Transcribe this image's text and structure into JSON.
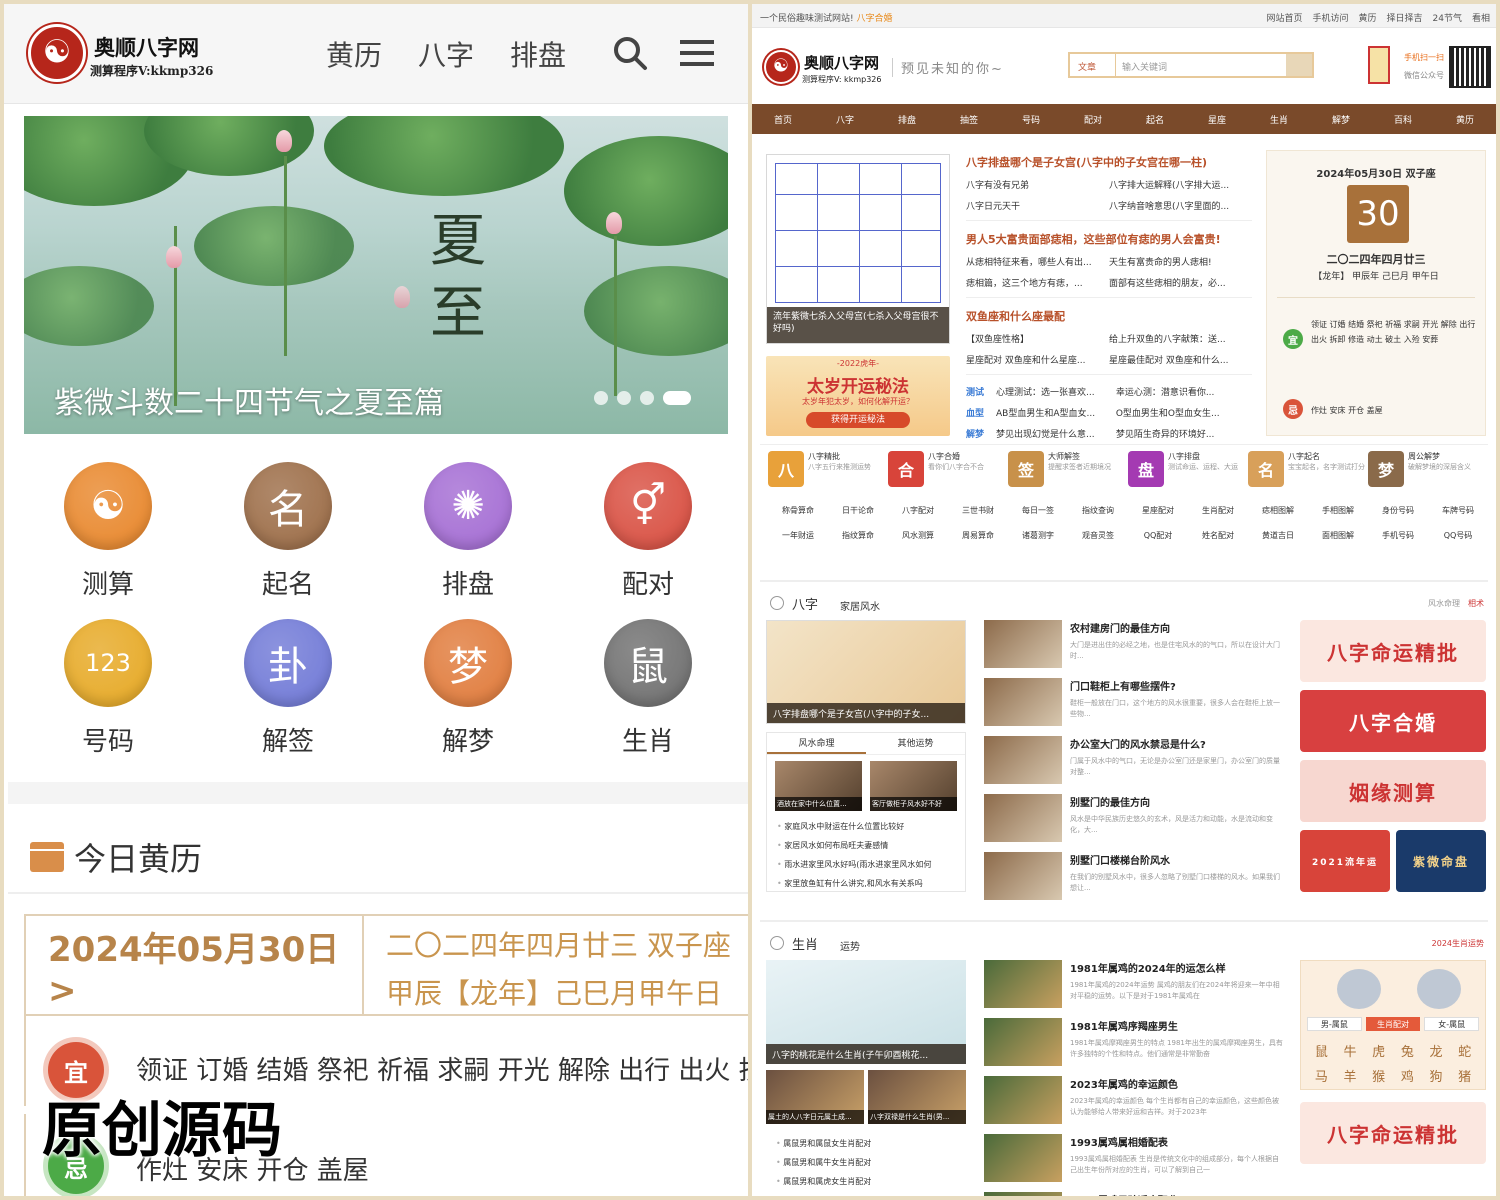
{
  "mobile": {
    "logo_name": "奥顺八字网",
    "logo_version": "测算程序V:kkmp326",
    "nav": [
      "黄历",
      "八字",
      "排盘"
    ],
    "banner": {
      "title_1": "夏",
      "title_2": "至",
      "caption": "紫微斗数二十四节气之夏至篇",
      "slides": 4,
      "active_slide": 4
    },
    "grid": [
      {
        "label": "测算",
        "icon": "yin-yang-icon",
        "color": "#e8862a",
        "glyph": "☯"
      },
      {
        "label": "起名",
        "icon": "name-seal-icon",
        "color": "#9b6b45",
        "glyph": "名"
      },
      {
        "label": "排盘",
        "icon": "compass-wheel-icon",
        "color": "#a36bd3",
        "glyph": "✺"
      },
      {
        "label": "配对",
        "icon": "gender-pair-icon",
        "color": "#d84d3f",
        "glyph": "⚥"
      },
      {
        "label": "号码",
        "icon": "number-123-icon",
        "color": "#e6a823",
        "glyph": "123"
      },
      {
        "label": "解签",
        "icon": "lottery-stick-icon",
        "color": "#6f78d6",
        "glyph": "卦"
      },
      {
        "label": "解梦",
        "icon": "dream-icon",
        "color": "#e07a3a",
        "glyph": "梦"
      },
      {
        "label": "生肖",
        "icon": "zodiac-rat-icon",
        "color": "#6e6e6e",
        "glyph": "鼠"
      }
    ],
    "almanac_title": "今日黄历",
    "date_solar": "2024年05月30日 >",
    "date_lunar_1": "二〇二四年四月廿三 双子座",
    "date_lunar_2": "甲辰【龙年】己巳月甲午日",
    "yi_label": "宜",
    "yi_text": "领证 订婚 结婚 祭祀 祈福 求嗣 开光 解除 出行 出火 拆",
    "ji_label": "忌",
    "ji_text": "作灶 安床 开仓 盖屋"
  },
  "watermark": "原创源码",
  "desktop": {
    "welcome": "一个民俗趣味测试网站!",
    "welcome_link": "八字合婚",
    "top_links": [
      "网站首页",
      "手机访问",
      "黄历",
      "择日择吉",
      "24节气",
      "看相"
    ],
    "logo_name": "奥顺八字网",
    "logo_version": "测算程序V: kkmp326",
    "slogan": "预见未知的你~",
    "search_select": "文章",
    "search_placeholder": "输入关键词",
    "qr_text": "手机扫一扫",
    "qr_text2": "微信公众号",
    "nav": [
      "首页",
      "八字",
      "排盘",
      "抽签",
      "号码",
      "配对",
      "起名",
      "星座",
      "生肖",
      "解梦",
      "百科",
      "黄历"
    ],
    "feature_caption": "流年紫微七杀入父母宫(七杀入父母宫很不好吗)",
    "ad_small": "-2022虎年-",
    "ad_title": "太岁开运秘法",
    "ad_sub": "太岁年犯太岁，如何化解开运？",
    "ad_button": "获得开运秘法",
    "articles": [
      {
        "title": "八字排盘哪个是子女宫(八字中的子女宫在哪一柱)",
        "rows": [
          [
            "八字有没有兄弟",
            "八字排大运解释(八字排大运..."
          ],
          [
            "八字日元天干",
            "八字纳音啥意思(八字里面的..."
          ]
        ]
      },
      {
        "title": "男人5大富贵面部痣相，这些部位有痣的男人会富贵!",
        "rows": [
          [
            "从痣相特征来看，哪些人有出...",
            "天生有富贵命的男人痣相!"
          ],
          [
            "痣相篇，这三个地方有痣，...",
            "面部有这些痣相的朋友，必..."
          ]
        ]
      },
      {
        "title": "双鱼座和什么座最配",
        "rows": [
          [
            "【双鱼座性格】",
            "给上升双鱼的八字献策：送..."
          ],
          [
            "星座配对 双鱼座和什么星座...",
            "星座最佳配对 双鱼座和什么..."
          ]
        ]
      }
    ],
    "tag_rows": [
      {
        "tag": "测试",
        "a": "心理测试：选一张喜欢...",
        "b": "幸运心测：潜意识看你..."
      },
      {
        "tag": "血型",
        "a": "AB型血男生和A型血女...",
        "b": "O型血男生和O型血女生..."
      },
      {
        "tag": "解梦",
        "a": "梦见出现幻觉是什么意...",
        "b": "梦见陌生奇异的环境好..."
      }
    ],
    "calendar": {
      "header": "2024年05月30日  双子座",
      "day": "30",
      "lunar": "二〇二四年四月廿三",
      "ganzhi": "【龙年】 甲辰年  己巳月  甲午日",
      "yi": "宜",
      "yi_text": "领证 订婚 结婚 祭祀 祈福 求嗣 开光 解除 出行 出火 拆卸 修造 动土 破土 入殓 安葬",
      "ji": "忌",
      "ji_text": "作灶 安床 开仓 盖屋"
    },
    "apps": [
      {
        "name": "八字精批",
        "desc": "八字五行来推测运势",
        "icon": "bazi-review-icon",
        "glyph": "八",
        "color": "#e8a13a"
      },
      {
        "name": "八字合婚",
        "desc": "看你们八字合不合",
        "icon": "bazi-marriage-icon",
        "glyph": "合",
        "color": "#d8443a"
      },
      {
        "name": "大师解签",
        "desc": "提醒求签者近期境况",
        "icon": "master-lottery-icon",
        "glyph": "签",
        "color": "#c8914a"
      },
      {
        "name": "八字排盘",
        "desc": "测试命运、运程、大运",
        "icon": "bazi-chart-icon",
        "glyph": "盘",
        "color": "#a43ab2"
      },
      {
        "name": "八字起名",
        "desc": "宝宝起名，名字测试打分",
        "icon": "bazi-naming-icon",
        "glyph": "名",
        "color": "#d8a05a"
      },
      {
        "name": "周公解梦",
        "desc": "破解梦境的深层含义",
        "icon": "zhougong-dream-icon",
        "glyph": "梦",
        "color": "#8a6a4a"
      }
    ],
    "tags": [
      "称骨算命",
      "日干论命",
      "八字配对",
      "三世书财",
      "每日一签",
      "指纹查询",
      "星座配对",
      "生肖配对",
      "痣相图解",
      "手相图解",
      "身份号码",
      "车牌号码",
      "一年财运",
      "指纹算命",
      "风水测算",
      "周易算命",
      "诸葛测字",
      "观音灵签",
      "QQ配对",
      "姓名配对",
      "黄道吉日",
      "面相图解",
      "手机号码",
      "QQ号码"
    ],
    "bazi_section": {
      "title": "八字",
      "sub": "家居风水",
      "right": "风水命理",
      "right2": "相术",
      "image_caption": "八字排盘哪个是子女宫(八字中的子女...",
      "tabs": [
        "风水命理",
        "其他运势"
      ],
      "thumbs": [
        "酒放在家中什么位置...",
        "客厅做柜子风水好不好"
      ],
      "list": [
        "家庭风水中财运在什么位置比较好",
        "家居风水如何布局旺夫妻感情",
        "雨水进家里风水好吗(雨水进家里风水如何",
        "家里放鱼缸有什么讲究,和风水有关系吗"
      ],
      "items": [
        {
          "title": "农村建房门的最佳方向",
          "desc": "大门是进出住的必经之地，也是住宅风水的的气口，所以在设计大门时..."
        },
        {
          "title": "门口鞋柜上有哪些摆件?",
          "desc": "鞋柜一般放在门口，这个地方的风水很重要，很多人会在鞋柜上放一些物..."
        },
        {
          "title": "办公室大门的风水禁忌是什么?",
          "desc": "门属于风水中的气口，无论是办公室门还是家里门，办公室门的质量对整..."
        },
        {
          "title": "别墅门的最佳方向",
          "desc": "风水是中华民族历史悠久的玄术，风是活力和动能，水是流动和变化，大..."
        },
        {
          "title": "别墅门口楼梯台阶风水",
          "desc": "在我们的别墅风水中，很多人忽略了别墅门口楼梯的风水。如果我们想让..."
        }
      ],
      "ads": [
        "八字命运精批",
        "八字合婚",
        "姻缘测算"
      ],
      "ad_small_1": "2021流年运",
      "ad_small_2": "紫微命盘"
    },
    "zodiac_section": {
      "title": "生肖",
      "sub": "运势",
      "right": "2024生肖运势",
      "image_caption": "八字的桃花是什么生肖(子午卯酉桃花...",
      "thumbs": [
        "属土的人八字日元属土成...",
        "八字双禄是什么生肖(男..."
      ],
      "list": [
        "属鼠男和属鼠女生肖配对",
        "属鼠男和属牛女生肖配对",
        "属鼠男和属虎女生肖配对"
      ],
      "items": [
        {
          "title": "1981年属鸡的2024年的运怎么样",
          "desc": "1981年属鸡的2024年运势  属鸡的朋友们在2024年将迎来一年中相对平稳的运势。以下是对于1981年属鸡在"
        },
        {
          "title": "1981年属鸡序羯座男生",
          "desc": "1981年属鸡摩羯座男生的特点  1981年出生的属鸡摩羯座男生，具有许多独特的个性和特点。他们通常是非常勤奋"
        },
        {
          "title": "2023年属鸡的幸运颜色",
          "desc": "2023年属鸡的幸运颜色  每个生肖都有自己的幸运颜色，这些颜色被认为能够给人带来好运和吉祥。对于2023年"
        },
        {
          "title": "1993属鸡属相婚配表",
          "desc": "1993属鸡属相婚配表  生肖是传统文化中的组成部分，每个人根据自己出生年份所对应的生肖，可以了解到自己一"
        },
        {
          "title": "2005属鸡男孩适合职业",
          "desc": ""
        }
      ],
      "pair_select": [
        "男-属鼠",
        "生肖配对",
        "女-属鼠"
      ],
      "animals": [
        "鼠",
        "牛",
        "虎",
        "兔",
        "龙",
        "蛇",
        "马",
        "羊",
        "猴",
        "鸡",
        "狗",
        "猪"
      ],
      "ad": "八字命运精批"
    }
  }
}
